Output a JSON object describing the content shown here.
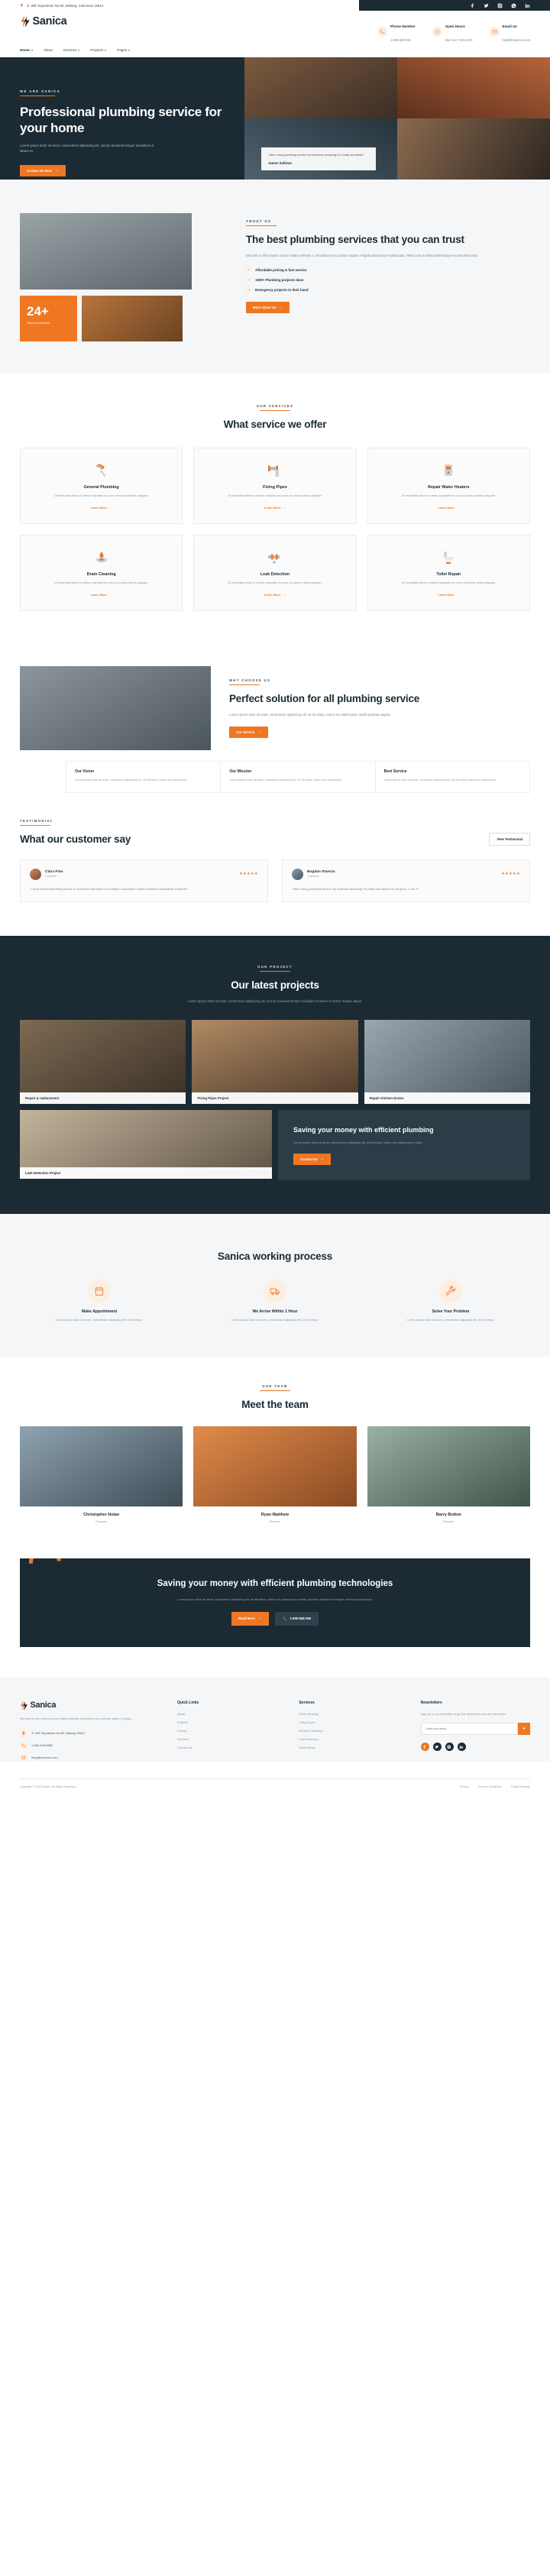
{
  "topbar": {
    "address": "Jl. WR Supratman No.80, Malang, Indonesia 15612",
    "socials": [
      "facebook-icon",
      "twitter-icon",
      "instagram-icon",
      "whatsapp-icon",
      "linkedin-icon"
    ]
  },
  "header": {
    "brand": "Sanica",
    "contacts": [
      {
        "icon": "phone-icon",
        "label": "Phone Number",
        "value": "1-800-508-266"
      },
      {
        "icon": "clock-icon",
        "label": "Open Hours",
        "value": "Mon Sat 7:00-18:00"
      },
      {
        "icon": "mail-icon",
        "label": "Email Us",
        "value": "help@tokomoo.com"
      }
    ]
  },
  "nav": {
    "items": [
      {
        "label": "Home",
        "caret": true,
        "active": true
      },
      {
        "label": "About",
        "caret": false,
        "active": false
      },
      {
        "label": "Services",
        "caret": true,
        "active": false
      },
      {
        "label": "Projects",
        "caret": true,
        "active": false
      },
      {
        "label": "Pages",
        "caret": true,
        "active": false
      }
    ]
  },
  "hero": {
    "eyebrow": "WE ARE SANICA",
    "title": "Professional plumbing service for your home",
    "paragraph": "Lorem ipsum dolor sit amet, consectetur adipiscing elit, sed do eiusmod tempor incididunt ut labore et.",
    "cta": "Contact Us Now",
    "quote": "\"After using plumbing service the business amazing! It's really wonderful\"",
    "quote_author": "James Sullivan"
  },
  "about": {
    "eyebrow": "ABOUT US",
    "title": "The best plumbing services that you can trust",
    "paragraph": "Est ante in nibh mauris cursus mattis molestie a. Tincidunt nunc pulvinar sapien et ligula ullamcorper malesuada. Tellus cras in tellus pellentesque eu tincidunt tortor.",
    "badge_number": "24+",
    "badge_label": "Years Experience",
    "checks": [
      "Affordable pricing & fast service",
      "1000+ Plumbing projects done",
      "Emergency projects in their hand"
    ],
    "cta": "More About Us"
  },
  "services": {
    "eyebrow": "OUR SERVICES",
    "title": "What service we offer",
    "learn_label": "Learn More",
    "items": [
      {
        "icon": "hammer-icon",
        "title": "General Plumbing",
        "desc": "Ut venenatis tellus in metus vulputate eu nunc id cursus metus aliquam."
      },
      {
        "icon": "pipe-icon",
        "title": "Fixing Pipes",
        "desc": "Ut venenatis tellus in metus vulputate eu nunc id cursus metus aliquam."
      },
      {
        "icon": "water-heater-icon",
        "title": "Repair Water Heaters",
        "desc": "Ut venenatis tellus in metus vulputate eu nunc id cursus metus aliquam."
      },
      {
        "icon": "drain-icon",
        "title": "Drain Cleaning",
        "desc": "Ut venenatis tellus in metus vulputate eu nunc id cursus metus aliquam."
      },
      {
        "icon": "leak-icon",
        "title": "Leak Detection",
        "desc": "Ut venenatis tellus in metus vulputate eu nunc id cursus metus aliquam."
      },
      {
        "icon": "toilet-icon",
        "title": "Toilet Repair",
        "desc": "Ut venenatis tellus in metus vulputate eu nunc id cursus metus aliquam."
      }
    ]
  },
  "why": {
    "eyebrow": "WHY CHOOSE US",
    "title": "Perfect solution for all plumbing service",
    "paragraph": "Lorem ipsum dolor sit amet, consectetur adipiscing elit, sit do tellus, cursus leo ullamcorper mattis pulvinar sagittis.",
    "cta": "Our Service",
    "boxes": [
      {
        "title": "Our Vision",
        "desc": "Lorem ipsum dolor sit amet, consetetur adipiscing elit, sit elit tellus, luctus nec ullamcorper."
      },
      {
        "title": "Our Mission",
        "desc": "Lorem ipsum dolor sit amet, consetetur adipiscing elit, sit elit tellus, luctus nec ullamcorper."
      },
      {
        "title": "Best Service",
        "desc": "Lorem ipsum dolor sit amet, consetetur adipiscing elit, sit elit tellus, luctus nec ullamcorper."
      }
    ]
  },
  "testimonial": {
    "eyebrow": "TESTIMONIAL",
    "title": "What our customer say",
    "view_all": "View Testimonial",
    "items": [
      {
        "name": "Clara Finn",
        "role": "Customer",
        "stars": "★★★★★",
        "quote": "\"I recommend plumbing service to everyone interested in running a successful online business! Absolutely wonderful\""
      },
      {
        "name": "Bogdan Stanciu",
        "role": "Customer",
        "stars": "★★★★★",
        "quote": "\"After using plumbing service my business amazing! It's really wonderful! It's all good, I Like it\""
      }
    ]
  },
  "projects": {
    "eyebrow": "OUR PROJECT",
    "title": "Our latest projects",
    "paragraph": "Lorem ipsum dolor sit amet, consectetur adipiscing elit, sed do eiusmod tempor incididunt ut labore et dolore magna aliqua.",
    "items": [
      {
        "caption": "Repair & replacement"
      },
      {
        "caption": "Fixing Pipes Project"
      },
      {
        "caption": "Repair Kitchen Drains"
      },
      {
        "caption": "Leak Detection Project"
      }
    ],
    "promo_title": "Saving your money with efficient plumbing",
    "promo_paragraph": "Lorem ipsum dolor sit amet, consectetur adipiscing elit, sit elit tellus, luctus nec ullamcorper mattis.",
    "promo_cta": "Contact Us"
  },
  "process": {
    "title": "Sanica working process",
    "items": [
      {
        "icon": "calendar-icon",
        "title": "Make Appointment",
        "desc": "Lorem ipsum dolor sit amet, consectetur adipiscing elit, sit elit tellus."
      },
      {
        "icon": "truck-icon",
        "title": "We Arrive Within 1 Hour",
        "desc": "Lorem ipsum dolor sit amet, consectetur adipiscing elit, sit elit tellus."
      },
      {
        "icon": "wrench-icon",
        "title": "Solve Your Problem",
        "desc": "Lorem ipsum dolor sit amet, consectetur adipiscing elit, sit elit tellus."
      }
    ]
  },
  "team": {
    "eyebrow": "OUR TEAM",
    "title": "Meet the team",
    "members": [
      {
        "name": "Christopher Nolan",
        "role": "Founder"
      },
      {
        "name": "Ryan Matthew",
        "role": "Plumber"
      },
      {
        "name": "Barry Button",
        "role": "Plumber"
      }
    ]
  },
  "cta": {
    "title": "Saving your money with efficient plumbing technologies",
    "paragraph": "Lorem ipsum dolor sit amet, consectetur adipiscing elit, sit elit tellus, luctus nec ullamcorper mattis, pulvinar dapibus leo tempor sed eiusmod tempor.",
    "primary": "Read More",
    "secondary": "1-800-508-266",
    "secondary_icon": "phone-icon"
  },
  "footer": {
    "brand": "Sanica",
    "description": "Est ante in nibh mauris cursus mattis molestie a tincidunt nunc pulvinar sapien et ligula.",
    "contacts": [
      {
        "icon": "pin-icon",
        "text": "Jl. WR Supratman No.80, Malang 15612"
      },
      {
        "icon": "phone-icon",
        "text": "1-800-508-0888"
      },
      {
        "icon": "mail-icon",
        "text": "help@tokomoo.com"
      }
    ],
    "columns": [
      {
        "title": "Quick Links",
        "links": [
          "About",
          "Projects",
          "Pricing",
          "Services",
          "Contact Us"
        ]
      },
      {
        "title": "Services",
        "links": [
          "Drain Cleaning",
          "Fixing Pipes",
          "General Plumbing",
          "Leak Detection",
          "Toilet Repair"
        ]
      }
    ],
    "newsletter": {
      "title": "Newsletters",
      "desc": "Sign up to our newsletter to get the latest news and our best deals.",
      "placeholder": "Enter your email...",
      "button_icon": "send-icon"
    },
    "socials": [
      "facebook-icon",
      "twitter-icon",
      "instagram-icon",
      "linkedin-icon"
    ],
    "copyright": "Copyright © 2023 Sanica. All Rights Reserved",
    "bottom_links": [
      "Privacy",
      "Terms & Conditions",
      "Cookie Settings"
    ]
  },
  "colors": {
    "accent": "#ef7722",
    "dark": "#1b2a33",
    "muted": "#8b969e"
  }
}
